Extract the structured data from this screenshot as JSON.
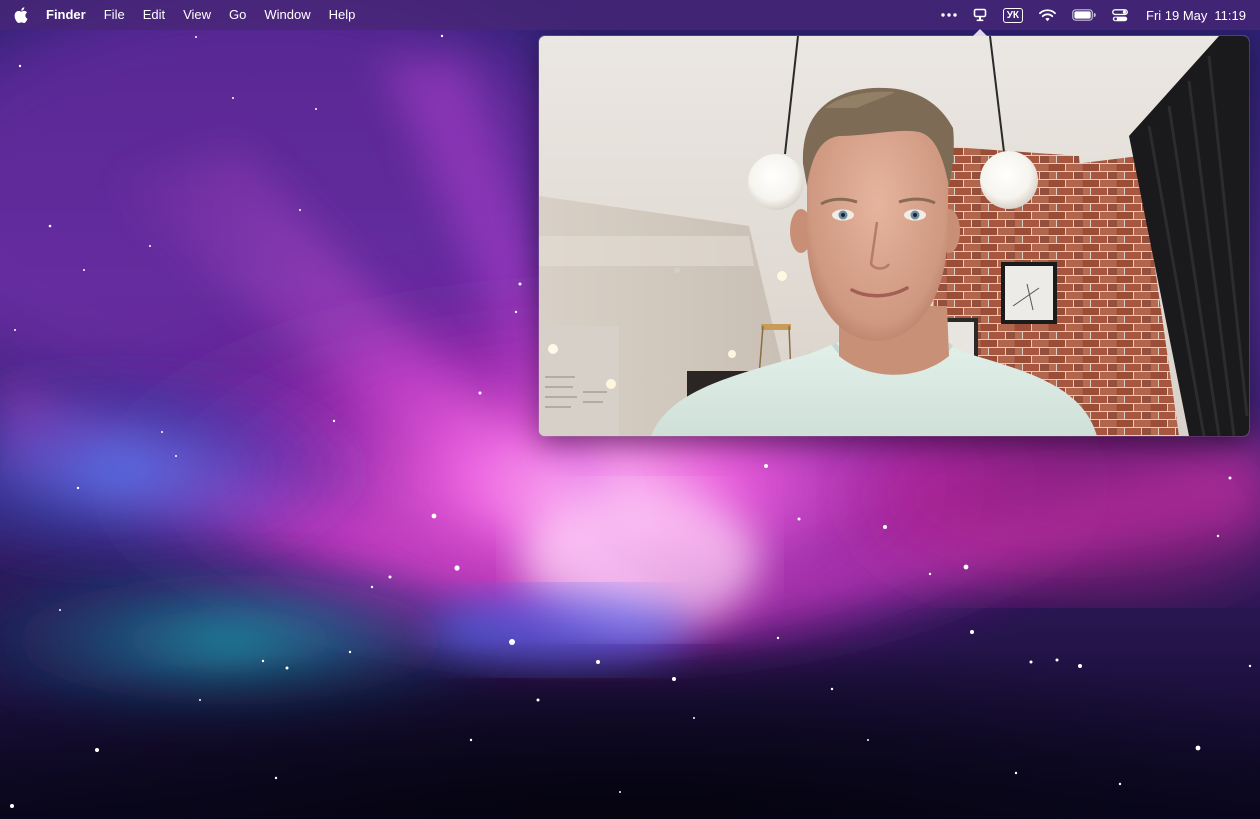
{
  "menubar": {
    "apple_icon": "apple-logo-icon",
    "app_name": "Finder",
    "menus": [
      "File",
      "Edit",
      "View",
      "Go",
      "Window",
      "Help"
    ],
    "status": {
      "more_icon": "more-dots-icon",
      "camera_icon": "camera-preview-icon",
      "input_source": "УК",
      "wifi_icon": "wifi-icon",
      "battery_icon": "battery-icon",
      "control_center_icon": "control-center-icon"
    },
    "date": "Fri 19 May",
    "time": "11:19"
  },
  "camera_preview": {
    "content": "webcam-feed",
    "visible": true
  },
  "colors": {
    "menubar_bg": "#482676",
    "wallpaper_magenta": "#e93bd6",
    "wallpaper_blue": "#2a2fa8",
    "wallpaper_teal": "#1a8a9c",
    "wallpaper_night": "#0b0820"
  }
}
